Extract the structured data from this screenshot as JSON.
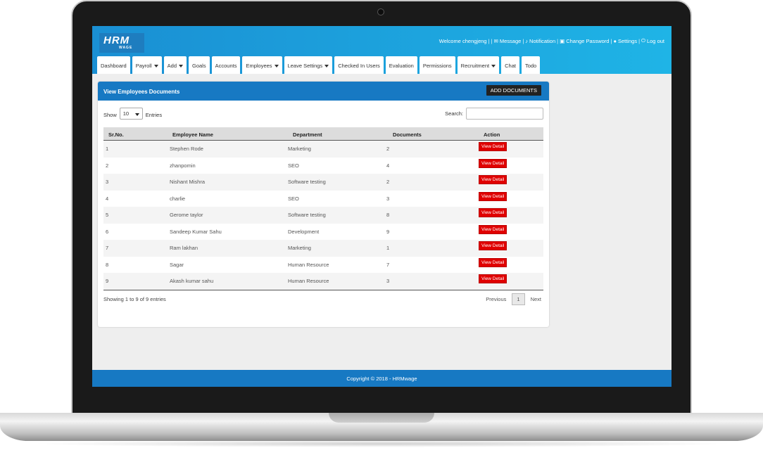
{
  "app": {
    "logo_text": "HRM",
    "logo_sub": "WAGE"
  },
  "topbar": {
    "welcome": "Welcome chengjeng",
    "message": "Message",
    "notification": "Notification",
    "change_password": "Change Password",
    "settings": "Settings",
    "logout": "Log out"
  },
  "nav": [
    {
      "label": "Dashboard",
      "dropdown": false
    },
    {
      "label": "Payroll",
      "dropdown": true
    },
    {
      "label": "Add",
      "dropdown": true
    },
    {
      "label": "Goals",
      "dropdown": false
    },
    {
      "label": "Accounts",
      "dropdown": false
    },
    {
      "label": "Employees",
      "dropdown": true
    },
    {
      "label": "Leave Settings",
      "dropdown": true
    },
    {
      "label": "Checked In Users",
      "dropdown": false
    },
    {
      "label": "Evaluation",
      "dropdown": false
    },
    {
      "label": "Permissions",
      "dropdown": false
    },
    {
      "label": "Recruitment",
      "dropdown": true
    },
    {
      "label": "Chat",
      "dropdown": false
    },
    {
      "label": "Todo",
      "dropdown": false
    }
  ],
  "panel": {
    "title": "View Employees Documents",
    "add_button": "ADD DOCUMENTS",
    "show_label": "Show",
    "entries_value": "10",
    "entries_label": "Entries",
    "search_label": "Search:",
    "search_value": ""
  },
  "table": {
    "headers": [
      "Sr.No.",
      "Employee Name",
      "Department",
      "Documents",
      "Action"
    ],
    "rows": [
      {
        "sr": "1",
        "name": "Stephen Rode",
        "department": "Marketing",
        "documents": "2",
        "action": "View Detail"
      },
      {
        "sr": "2",
        "name": "zhanpomin",
        "department": "SEO",
        "documents": "4",
        "action": "View Detail"
      },
      {
        "sr": "3",
        "name": "Nishant Mishra",
        "department": "Software testing",
        "documents": "2",
        "action": "View Detail"
      },
      {
        "sr": "4",
        "name": "charlie",
        "department": "SEO",
        "documents": "3",
        "action": "View Detail"
      },
      {
        "sr": "5",
        "name": "Gerome taylor",
        "department": "Software testing",
        "documents": "8",
        "action": "View Detail"
      },
      {
        "sr": "6",
        "name": "Sandeep Kumar Sahu",
        "department": "Development",
        "documents": "9",
        "action": "View Detail"
      },
      {
        "sr": "7",
        "name": "Ram lakhan",
        "department": "Marketing",
        "documents": "1",
        "action": "View Detail"
      },
      {
        "sr": "8",
        "name": "Sagar",
        "department": "Human Resource",
        "documents": "7",
        "action": "View Detail"
      },
      {
        "sr": "9",
        "name": "Akash kumar sahu",
        "department": "Human Resource",
        "documents": "3",
        "action": "View Detail"
      }
    ]
  },
  "pagination": {
    "info": "Showing 1 to 9 of 9 entries",
    "previous": "Previous",
    "current": "1",
    "next": "Next"
  },
  "footer": {
    "text": "Copyright © 2018 - HRMwage"
  },
  "colors": {
    "header_gradient_start": "#1a8fd3",
    "header_gradient_end": "#1fb4e6",
    "panel_header": "#1779c3",
    "view_detail": "#e00000"
  }
}
